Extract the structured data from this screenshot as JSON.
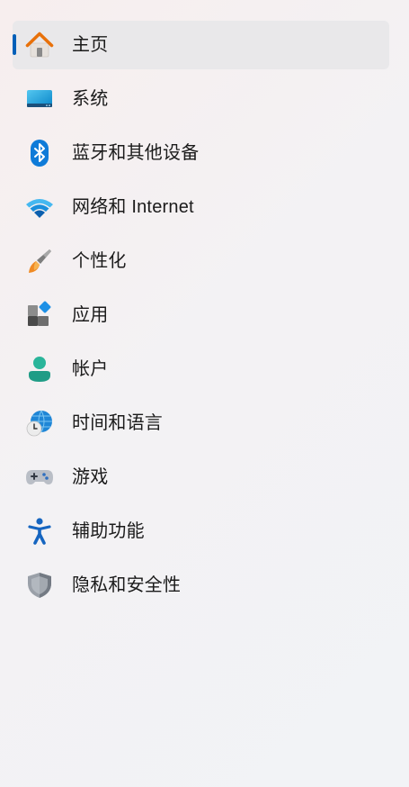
{
  "nav": {
    "items": [
      {
        "label": "主页",
        "icon": "home-icon",
        "selected": true
      },
      {
        "label": "系统",
        "icon": "monitor-icon"
      },
      {
        "label": "蓝牙和其他设备",
        "icon": "bluetooth-icon"
      },
      {
        "label": "网络和 Internet",
        "icon": "wifi-icon"
      },
      {
        "label": "个性化",
        "icon": "paintbrush-icon"
      },
      {
        "label": "应用",
        "icon": "apps-icon"
      },
      {
        "label": "帐户",
        "icon": "account-icon"
      },
      {
        "label": "时间和语言",
        "icon": "globe-clock-icon"
      },
      {
        "label": "游戏",
        "icon": "gamepad-icon"
      },
      {
        "label": "辅助功能",
        "icon": "accessibility-icon"
      },
      {
        "label": "隐私和安全性",
        "icon": "shield-icon"
      }
    ]
  },
  "colors": {
    "accent": "#005fb8",
    "selected_background": "#e9e8ea"
  }
}
